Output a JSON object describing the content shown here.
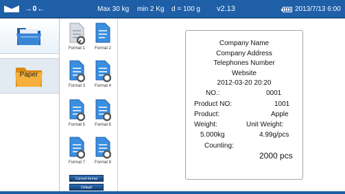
{
  "status_bar": {
    "zero_indicator": "→0←",
    "max_capacity": "Max 30 kg",
    "min_capacity": "min 2 Kg",
    "division": "d = 100 g",
    "version": "v2.13",
    "datetime": "2013/7/13  6:00"
  },
  "sidebar": {
    "items": [
      {
        "label": "",
        "icon": "folder-icon"
      },
      {
        "label": "Paper",
        "icon": "paper-folder-icon"
      }
    ]
  },
  "formats": {
    "items": [
      {
        "label": "Format 1"
      },
      {
        "label": "Format 2"
      },
      {
        "label": "Format 3"
      },
      {
        "label": "Format 4"
      },
      {
        "label": "Format 5"
      },
      {
        "label": "Format 6"
      },
      {
        "label": "Format 7"
      },
      {
        "label": "Format 8"
      }
    ],
    "current_button": "Current format",
    "default_button": "Default"
  },
  "label_preview": {
    "company_name": "Company Name",
    "company_address": "Company Address",
    "telephone": "Telephones Number",
    "website": "Website",
    "timestamp": "2012-03-20 20:20",
    "no_label": "NO.:",
    "no_value": "0001",
    "product_no_label": "Product NO:",
    "product_no_value": "1001",
    "product_label": "Product:",
    "product_value": "Apple",
    "weight_label": "Weight:",
    "unit_weight_label": "Unit Weight:",
    "weight_value": "5.000kg",
    "unit_weight_value": "4.99g/pcs",
    "counting_label": "Counting:",
    "counting_value": "2000 pcs"
  },
  "colors": {
    "status_bar": "#1e5fa8",
    "button": "#123d73",
    "folder_blue": "#2a6fc0",
    "folder_orange": "#f0a020"
  }
}
